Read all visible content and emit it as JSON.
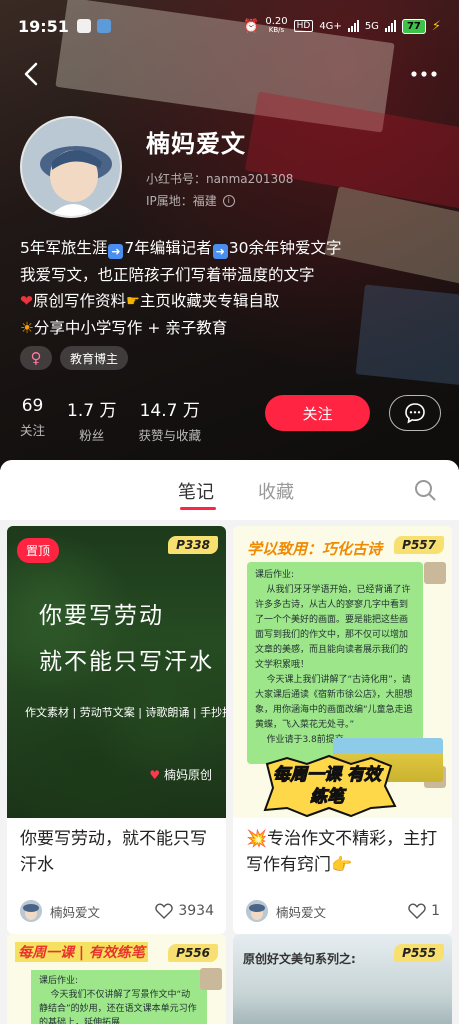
{
  "status_bar": {
    "time": "19:51",
    "net_speed": "0.20",
    "net_unit": "KB/s",
    "net_hd": "HD",
    "net_4g": "4G+",
    "net_5g": "5G",
    "battery": "77"
  },
  "profile": {
    "name": "楠妈爱文",
    "user_id": "小红书号：nanma201308",
    "ip": "IP属地：福建",
    "bio": {
      "line1_a": "5年军旅生涯",
      "line1_b": "7年编辑记者",
      "line1_c": "30余年钟爱文字",
      "line2": "我爱写文，也正陪孩子们写着带温度的文字",
      "line3_a": "原创写作资料",
      "line3_b": "主页收藏夹专辑自取",
      "line4": "分享中小学写作 + 亲子教育"
    },
    "tags": [
      "♀",
      "教育博主"
    ],
    "stats": [
      {
        "num": "69",
        "label": "关注"
      },
      {
        "num": "1.7 万",
        "label": "粉丝"
      },
      {
        "num": "14.7 万",
        "label": "获赞与收藏"
      }
    ],
    "follow_label": "关注"
  },
  "tabs": [
    {
      "label": "笔记",
      "active": true
    },
    {
      "label": "收藏",
      "active": false
    }
  ],
  "posts": [
    {
      "pinned": "置顶",
      "badge": "P338",
      "cover_line1": "你要写劳动",
      "cover_line2": "就不能只写汗水",
      "cover_sub": "作文素材 | 劳动节文案 | 诗歌朗诵 | 手抄报",
      "cover_sign": "楠妈原创",
      "title": "你要写劳动，就不能只写汗水",
      "author": "楠妈爱文",
      "likes": "3934"
    },
    {
      "badge": "P557",
      "cover_head": "学以致用：巧化古诗",
      "cover_body": "课后作业:\n    从我们牙牙学语开始，已经背诵了许许多多古诗，从古人的寥寥几字中看到了一个个美好的画面。要是能把这些画面写到我们的作文中，那不仅可以增加文章的美感，而且能向读者展示我们的文学积累哦！\n    今天课上我们讲解了“古诗化用”，请大家课后通读《宿新市徐公店》，大胆想象，用你涵海中的画面改编“儿童急走追黄蝶，飞入菜花无处寻。”\n    作业请于3.8前提交",
      "cover_burst": "每周一课 有效练笔",
      "title_prefix": "💥",
      "title": "专治作文不精彩，主打写作有窍门",
      "title_suffix": "👉",
      "author": "楠妈爱文",
      "likes": "1"
    },
    {
      "badge": "P556",
      "cover_head": "每周一课 | 有效练笔",
      "cover_body": "课后作业:\n    今天我们不仅讲解了写景作文中“动静结合”的妙用，还在语文课本单元习作的基础上，延伸拓展"
    },
    {
      "badge": "P555",
      "cover_head": "原创好文美句系列之:"
    }
  ]
}
